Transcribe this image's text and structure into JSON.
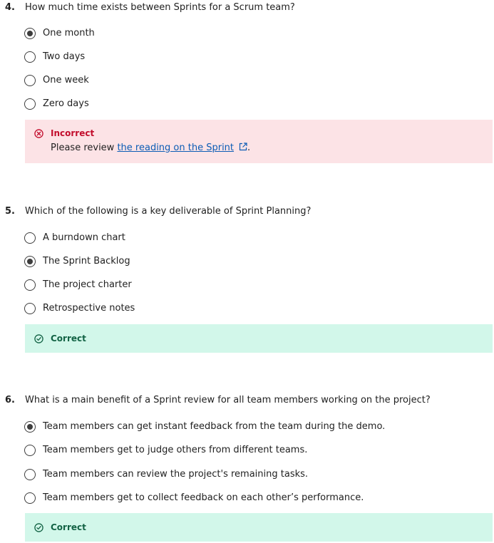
{
  "questions": [
    {
      "number": "4.",
      "text": "How much time exists between Sprints for a Scrum team?",
      "options": [
        {
          "label": "One month",
          "selected": true
        },
        {
          "label": "Two days",
          "selected": false
        },
        {
          "label": "One week",
          "selected": false
        },
        {
          "label": "Zero days",
          "selected": false
        }
      ],
      "feedback": {
        "status": "Incorrect",
        "message_prefix": "Please review ",
        "link_text": "the reading on the Sprint",
        "message_suffix": "."
      }
    },
    {
      "number": "5.",
      "text": "Which of the following is a key deliverable of Sprint Planning?",
      "options": [
        {
          "label": "A burndown chart",
          "selected": false
        },
        {
          "label": "The Sprint Backlog",
          "selected": true
        },
        {
          "label": "The project charter",
          "selected": false
        },
        {
          "label": "Retrospective notes",
          "selected": false
        }
      ],
      "feedback": {
        "status": "Correct"
      }
    },
    {
      "number": "6.",
      "text": "What is a main benefit of a Sprint review for all team members working on the project?",
      "options": [
        {
          "label": "Team members can get instant feedback from the team during the demo.",
          "selected": true
        },
        {
          "label": "Team members get to judge others from different teams.",
          "selected": false
        },
        {
          "label": "Team members can review the project's remaining tasks.",
          "selected": false
        },
        {
          "label": "Team members get to collect feedback on each other’s performance.",
          "selected": false
        }
      ],
      "feedback": {
        "status": "Correct"
      }
    }
  ],
  "colors": {
    "incorrect_bg": "#fce3e6",
    "incorrect_text": "#c20d2c",
    "correct_bg": "#d2f7ea",
    "correct_text": "#136345",
    "link": "#0b5cb5"
  }
}
